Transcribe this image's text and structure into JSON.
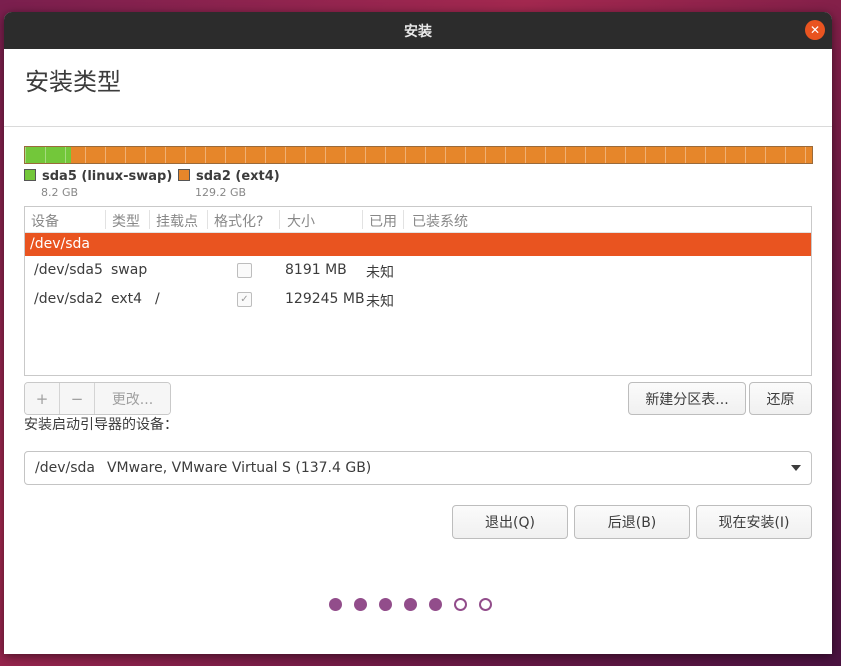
{
  "window": {
    "title": "安装"
  },
  "page": {
    "title": "安装类型"
  },
  "partition_bar": {
    "segments": [
      {
        "name": "sda5 (linux-swap)",
        "size": "8.2 GB",
        "color": "#73c73a",
        "fraction": 0.06
      },
      {
        "name": "sda2 (ext4)",
        "size": "129.2 GB",
        "color": "#e6862a",
        "fraction": 0.94
      }
    ]
  },
  "table": {
    "columns": [
      "设备",
      "类型",
      "挂载点",
      "格式化?",
      "大小",
      "已用",
      "已装系统"
    ],
    "selected_row": "/dev/sda",
    "rows": [
      {
        "device": "/dev/sda5",
        "type": "swap",
        "mount": "",
        "format": false,
        "size": "8191 MB",
        "used": "未知",
        "system": ""
      },
      {
        "device": "/dev/sda2",
        "type": "ext4",
        "mount": "/",
        "format": true,
        "size": "129245 MB",
        "used": "未知",
        "system": ""
      }
    ]
  },
  "toolbar": {
    "add": "+",
    "remove": "−",
    "change": "更改...",
    "new_table": "新建分区表...",
    "revert": "还原"
  },
  "boot": {
    "label": "安装启动引导器的设备：",
    "device": "/dev/sda",
    "description": "VMware, VMware Virtual S (137.4 GB)"
  },
  "buttons": {
    "quit": "退出(Q)",
    "back": "后退(B)",
    "install": "现在安装(I)"
  },
  "progress": {
    "total_steps": 7,
    "completed_steps": 5
  },
  "colors": {
    "accent": "#e95420",
    "progress_dot": "#924d8b",
    "titlebar": "#2c2c2c"
  },
  "icons": {
    "close": "close-icon",
    "checkbox_checked": "check-icon",
    "dropdown": "chevron-down-icon"
  }
}
